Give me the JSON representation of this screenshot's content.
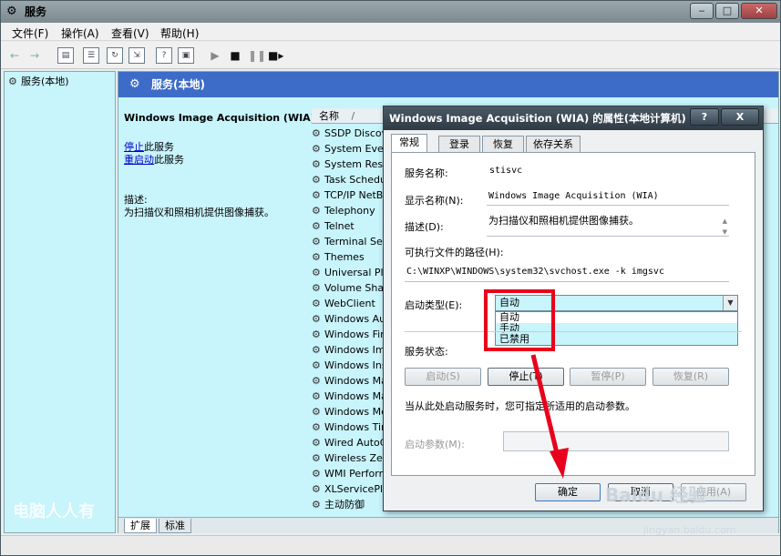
{
  "window": {
    "title": "服务",
    "controls": {
      "minimize": "‒",
      "restore": "□",
      "close": "✕"
    }
  },
  "menu": [
    "文件(F)",
    "操作(A)",
    "查看(V)",
    "帮助(H)"
  ],
  "tree": {
    "root": "服务(本地)"
  },
  "pane": {
    "header": "服务(本地)",
    "service_name": "Windows Image Acquisition (WIA)",
    "stop_link": "停止",
    "stop_suffix": "此服务",
    "restart_link": "重启动",
    "restart_suffix": "此服务",
    "desc_label": "描述:",
    "desc_text": "为扫描仪和照相机提供图像捕获。"
  },
  "list": {
    "col_name": "名称",
    "sort_arrow": "/",
    "rows": [
      "SSDP Discov",
      "System Even",
      "System Rest",
      "Task Schedu",
      "TCP/IP NetB",
      "Telephony",
      "Telnet",
      "Terminal Ser",
      "Themes",
      "Universal Plu",
      "Volume Shad",
      "WebClient",
      "Windows Au",
      "Windows Fir",
      "Windows Im",
      "Windows Ins",
      "Windows Ma",
      "Windows Ma",
      "Windows Me",
      "Windows Tir",
      "Wired AutoC",
      "Wireless Zer",
      "WMI Perforn",
      "XLServicePla",
      "主动防御"
    ]
  },
  "bottom_tabs": [
    "扩展",
    "标准"
  ],
  "dialog": {
    "title": "Windows Image Acquisition (WIA) 的属性(本地计算机)",
    "help_btn": "?",
    "close_btn": "X",
    "tabs": [
      "常规",
      "登录",
      "恢复",
      "依存关系"
    ],
    "svc_name_label": "服务名称:",
    "svc_name_value": "stisvc",
    "display_label": "显示名称(N):",
    "display_value": "Windows Image Acquisition (WIA)",
    "desc_label": "描述(D):",
    "desc_value": "为扫描仪和照相机提供图像捕获。",
    "path_label": "可执行文件的路径(H):",
    "path_value": "C:\\WINXP\\WINDOWS\\system32\\svchost.exe -k imgsvc",
    "startup_label": "启动类型(E):",
    "startup_value": "自动",
    "startup_options": [
      "自动",
      "手动",
      "已禁用"
    ],
    "status_label": "服务状态:",
    "btn_start": "启动(S)",
    "btn_stop": "停止(T)",
    "btn_pause": "暂停(P)",
    "btn_resume": "恢复(R)",
    "hint": "当从此处启动服务时，您可指定所适用的启动参数。",
    "param_label": "启动参数(M):",
    "ok": "确定",
    "cancel": "取消",
    "apply": "应用(A)"
  },
  "watermarks": {
    "left": "电脑人人有",
    "baidu": "Baidu 经验",
    "url": "jingyan.baidu.com"
  },
  "colors": {
    "accent": "#3c6cc8",
    "highlight_red": "#e8001c",
    "pane_bg": "#c8f4fc"
  }
}
